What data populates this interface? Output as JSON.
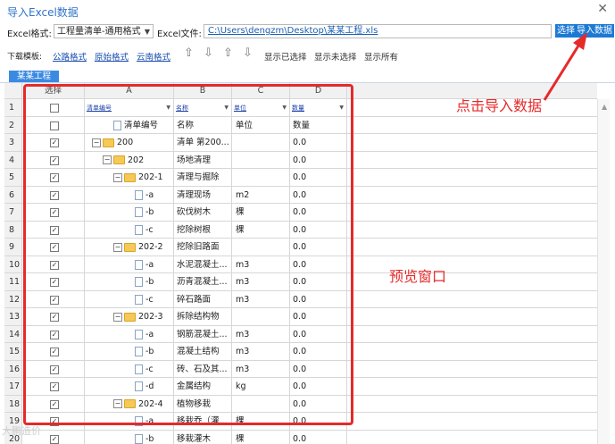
{
  "title": "导入Excel数据",
  "row1": {
    "format_label": "Excel格式:",
    "format_value": "工程量清单-通用格式",
    "file_label": "Excel文件:",
    "file_path": "C:\\Users\\dengzm\\Desktop\\某某工程.xls",
    "choose_label": "选择",
    "import_label": "导入数据"
  },
  "row2": {
    "template_label": "下载模板:",
    "links": [
      "公路格式",
      "原始格式",
      "云南格式"
    ],
    "tools": [
      "显示已选择",
      "显示未选择",
      "显示所有"
    ]
  },
  "tab_label": "某某工程",
  "grid": {
    "select_header": "选择",
    "columns": [
      "A",
      "B",
      "C",
      "D"
    ],
    "field_names": [
      "清单编号",
      "名称",
      "单位",
      "数量"
    ],
    "rows": [
      {
        "n": "1",
        "check": false,
        "code": "",
        "name": "",
        "unit": "",
        "qty": "",
        "fields": true
      },
      {
        "n": "2",
        "check": false,
        "code": "清单编号",
        "name": "名称",
        "unit": "单位",
        "qty": "数量",
        "indent": 1,
        "icon": "doc"
      },
      {
        "n": "3",
        "check": true,
        "code": "200",
        "name": "清单  第200...",
        "unit": "",
        "qty": "0.0",
        "indent": 0,
        "icon": "folder"
      },
      {
        "n": "4",
        "check": true,
        "code": "202",
        "name": "场地清理",
        "unit": "",
        "qty": "0.0",
        "indent": 1,
        "icon": "folder"
      },
      {
        "n": "5",
        "check": true,
        "code": "202-1",
        "name": "清理与掘除",
        "unit": "",
        "qty": "0.0",
        "indent": 2,
        "icon": "folder"
      },
      {
        "n": "6",
        "check": true,
        "code": "-a",
        "name": "清理现场",
        "unit": "m2",
        "qty": "0.0",
        "indent": 3,
        "icon": "doc"
      },
      {
        "n": "7",
        "check": true,
        "code": "-b",
        "name": "砍伐树木",
        "unit": "棵",
        "qty": "0.0",
        "indent": 3,
        "icon": "doc"
      },
      {
        "n": "8",
        "check": true,
        "code": "-c",
        "name": "挖除树根",
        "unit": "棵",
        "qty": "0.0",
        "indent": 3,
        "icon": "doc"
      },
      {
        "n": "9",
        "check": true,
        "code": "202-2",
        "name": "挖除旧路面",
        "unit": "",
        "qty": "0.0",
        "indent": 2,
        "icon": "folder"
      },
      {
        "n": "10",
        "check": true,
        "code": "-a",
        "name": "水泥混凝土...",
        "unit": "m3",
        "qty": "0.0",
        "indent": 3,
        "icon": "doc"
      },
      {
        "n": "11",
        "check": true,
        "code": "-b",
        "name": "沥青混凝土...",
        "unit": "m3",
        "qty": "0.0",
        "indent": 3,
        "icon": "doc"
      },
      {
        "n": "12",
        "check": true,
        "code": "-c",
        "name": "碎石路面",
        "unit": "m3",
        "qty": "0.0",
        "indent": 3,
        "icon": "doc"
      },
      {
        "n": "13",
        "check": true,
        "code": "202-3",
        "name": "拆除结构物",
        "unit": "",
        "qty": "0.0",
        "indent": 2,
        "icon": "folder"
      },
      {
        "n": "14",
        "check": true,
        "code": "-a",
        "name": "钢筋混凝土...",
        "unit": "m3",
        "qty": "0.0",
        "indent": 3,
        "icon": "doc"
      },
      {
        "n": "15",
        "check": true,
        "code": "-b",
        "name": "混凝土结构",
        "unit": "m3",
        "qty": "0.0",
        "indent": 3,
        "icon": "doc"
      },
      {
        "n": "16",
        "check": true,
        "code": "-c",
        "name": "砖、石及其...",
        "unit": "m3",
        "qty": "0.0",
        "indent": 3,
        "icon": "doc"
      },
      {
        "n": "17",
        "check": true,
        "code": "-d",
        "name": "金属结构",
        "unit": "kg",
        "qty": "0.0",
        "indent": 3,
        "icon": "doc"
      },
      {
        "n": "18",
        "check": true,
        "code": "202-4",
        "name": "植物移栽",
        "unit": "",
        "qty": "0.0",
        "indent": 2,
        "icon": "folder"
      },
      {
        "n": "19",
        "check": true,
        "code": "-a",
        "name": "移栽乔（灌...",
        "unit": "棵",
        "qty": "0.0",
        "indent": 3,
        "icon": "doc"
      },
      {
        "n": "20",
        "check": true,
        "code": "-b",
        "name": "移栽灌木",
        "unit": "棵",
        "qty": "0.0",
        "indent": 3,
        "icon": "doc"
      }
    ]
  },
  "annotations": {
    "import_hint": "点击导入数据",
    "preview_hint": "预览窗口"
  },
  "watermark": "大鹏造价",
  "colors": {
    "accent_blue": "#1c79d4",
    "annotation_red": "#e52a2a"
  }
}
